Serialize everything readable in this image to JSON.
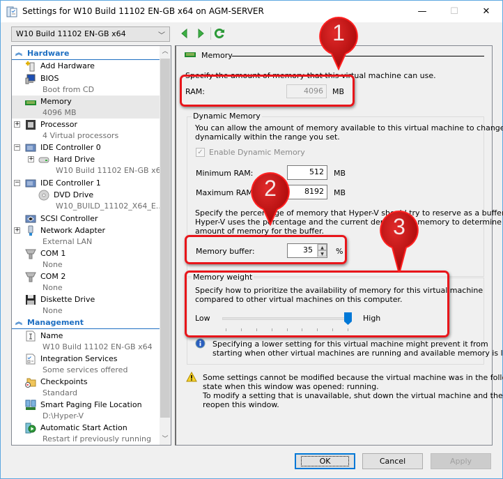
{
  "window": {
    "title": "Settings for W10 Build 11102 EN-GB x64 on AGM-SERVER",
    "controls": {
      "minimize": "—",
      "maximize": "☐",
      "close": "✕"
    }
  },
  "toolbar": {
    "vm_selected": "W10 Build 11102 EN-GB x64",
    "back_icon": "green-left-triangle",
    "forward_icon": "green-right-triangle",
    "refresh_icon": "green-refresh-arrow"
  },
  "sidebar": {
    "hardware_header": "Hardware",
    "management_header": "Management",
    "hardware_items": [
      {
        "label": "Add Hardware",
        "sub": "",
        "icon": "add-hardware"
      },
      {
        "label": "BIOS",
        "sub": "Boot from CD",
        "icon": "bios"
      },
      {
        "label": "Memory",
        "sub": "4096 MB",
        "icon": "memory",
        "selected": true
      },
      {
        "label": "Processor",
        "sub": "4 Virtual processors",
        "icon": "processor",
        "expander": "+"
      },
      {
        "label": "IDE Controller 0",
        "sub": "",
        "icon": "ide-controller",
        "expander": "−"
      },
      {
        "label": "Hard Drive",
        "sub": "W10 Build 11102 EN-GB x6...",
        "icon": "hard-drive",
        "expander": "+"
      },
      {
        "label": "IDE Controller 1",
        "sub": "",
        "icon": "ide-controller",
        "expander": "−"
      },
      {
        "label": "DVD Drive",
        "sub": "W10_BUILD_11102_X64_E...",
        "icon": "dvd-drive"
      },
      {
        "label": "SCSI Controller",
        "sub": "",
        "icon": "scsi-controller"
      },
      {
        "label": "Network Adapter",
        "sub": "External LAN",
        "icon": "network-adapter",
        "expander": "+"
      },
      {
        "label": "COM 1",
        "sub": "None",
        "icon": "com-port"
      },
      {
        "label": "COM 2",
        "sub": "None",
        "icon": "com-port"
      },
      {
        "label": "Diskette Drive",
        "sub": "None",
        "icon": "diskette"
      }
    ],
    "management_items": [
      {
        "label": "Name",
        "sub": "W10 Build 11102 EN-GB x64",
        "icon": "name"
      },
      {
        "label": "Integration Services",
        "sub": "Some services offered",
        "icon": "integration-services"
      },
      {
        "label": "Checkpoints",
        "sub": "Standard",
        "icon": "checkpoints"
      },
      {
        "label": "Smart Paging File Location",
        "sub": "D:\\Hyper-V",
        "icon": "smart-paging"
      },
      {
        "label": "Automatic Start Action",
        "sub": "Restart if previously running",
        "icon": "auto-start"
      }
    ]
  },
  "memory": {
    "header": "Memory",
    "intro": "Specify the amount of memory that this virtual machine can use.",
    "ram_label": "RAM:",
    "ram_value": "4096",
    "ram_unit": "MB",
    "dynamic": {
      "title": "Dynamic Memory",
      "desc_1": "You can allow the amount of memory available to this virtual machine to change",
      "desc_2": "dynamically within the range you set.",
      "enable_label": "Enable Dynamic Memory",
      "enable_checked": true,
      "min_label": "Minimum RAM:",
      "min_value": "512",
      "max_label": "Maximum RAM:",
      "max_value": "8192",
      "unit": "MB",
      "buffer_desc_1": "Specify the percentage of memory that Hyper-V should try to reserve as a buffer.",
      "buffer_desc_2": "Hyper-V uses the percentage and the current demand for memory to determine an",
      "buffer_desc_3": "amount of memory for the buffer.",
      "buffer_label": "Memory buffer:",
      "buffer_value": "35",
      "buffer_unit": "%"
    },
    "weight": {
      "title": "Memory weight",
      "desc_1": "Specify how to prioritize the availability of memory for this virtual machine",
      "desc_2": "compared to other virtual machines on this computer.",
      "low_label": "Low",
      "high_label": "High",
      "value_fraction": 1.0,
      "tick_count": 9
    },
    "info_1": "Specifying a lower setting for this virtual machine might prevent it from",
    "info_2": "starting when other virtual machines are running and available memory is low.",
    "warning_1": "Some settings cannot be modified because the virtual machine was in the following",
    "warning_2": "state when this window was opened: running.",
    "warning_3": "To modify a setting that is unavailable, shut down the virtual machine and then",
    "warning_4": "reopen this window."
  },
  "buttons": {
    "ok": "OK",
    "cancel": "Cancel",
    "apply": "Apply"
  },
  "callouts": [
    {
      "number": "1",
      "target": "RAM"
    },
    {
      "number": "2",
      "target": "Memory buffer"
    },
    {
      "number": "3",
      "target": "Memory weight"
    }
  ],
  "colors": {
    "accent": "#1e6fc2",
    "callout_red": "#e8151a",
    "slider_thumb": "#0078d7"
  }
}
